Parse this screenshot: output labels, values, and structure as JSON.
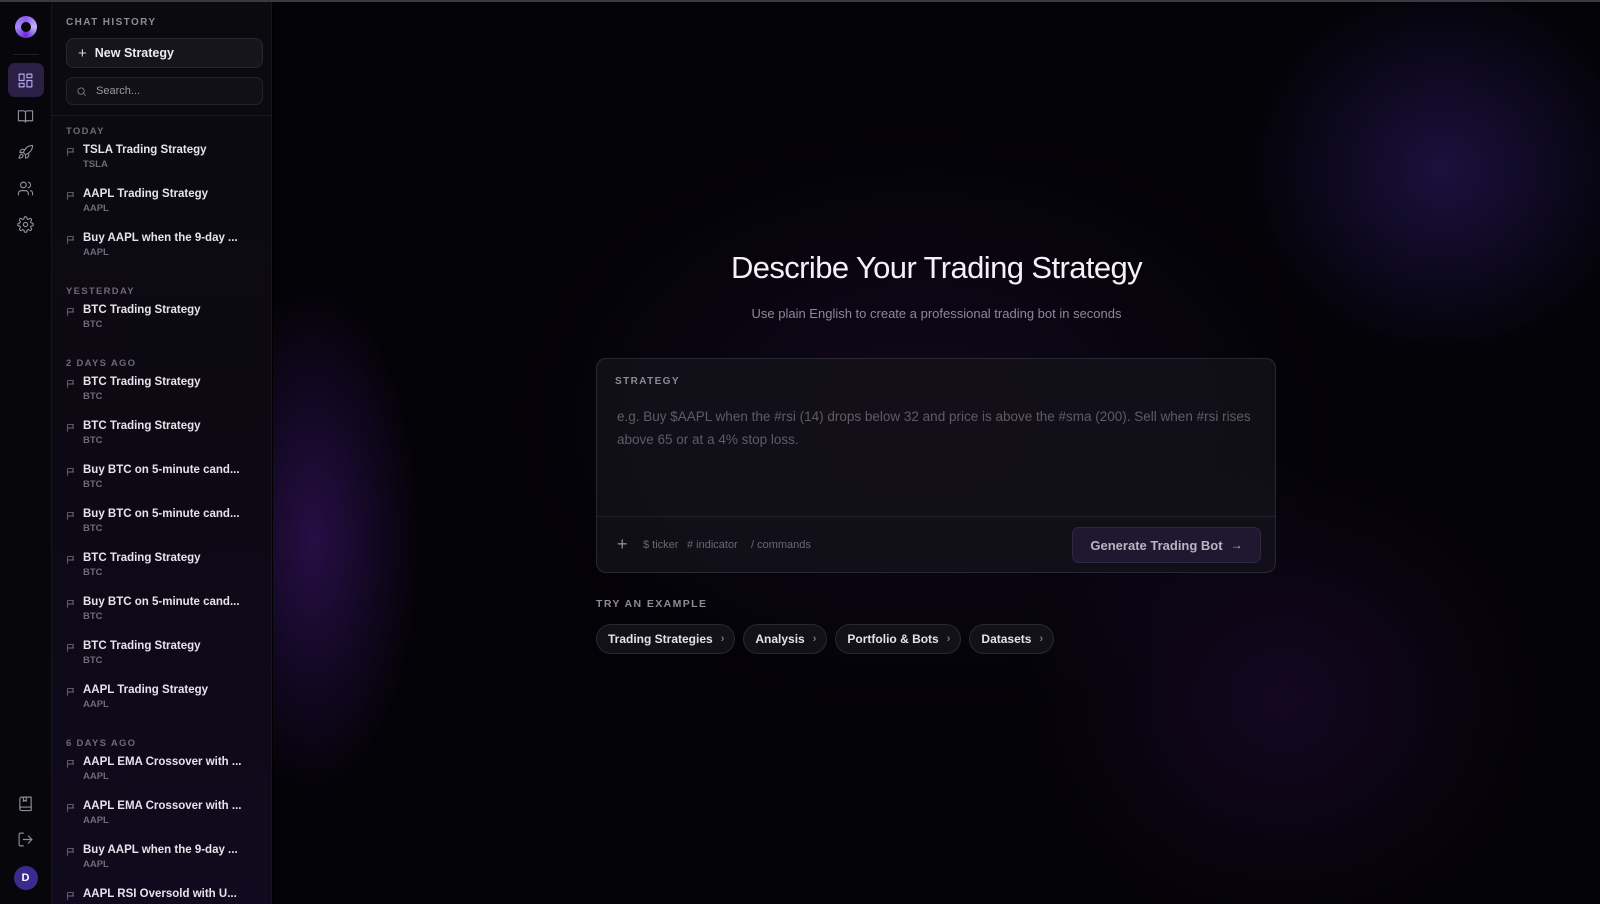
{
  "sidebar": {
    "title": "CHAT HISTORY",
    "new_button": "New Strategy",
    "search_placeholder": "Search...",
    "groups": [
      {
        "label": "TODAY",
        "items": [
          {
            "title": "TSLA Trading Strategy",
            "ticker": "TSLA"
          },
          {
            "title": "AAPL Trading Strategy",
            "ticker": "AAPL"
          },
          {
            "title": "Buy AAPL when the 9-day ...",
            "ticker": "AAPL"
          }
        ]
      },
      {
        "label": "YESTERDAY",
        "items": [
          {
            "title": "BTC Trading Strategy",
            "ticker": "BTC"
          }
        ]
      },
      {
        "label": "2 DAYS AGO",
        "items": [
          {
            "title": "BTC Trading Strategy",
            "ticker": "BTC"
          },
          {
            "title": "BTC Trading Strategy",
            "ticker": "BTC"
          },
          {
            "title": "Buy BTC on 5-minute cand...",
            "ticker": "BTC"
          },
          {
            "title": "Buy BTC on 5-minute cand...",
            "ticker": "BTC"
          },
          {
            "title": "BTC Trading Strategy",
            "ticker": "BTC"
          },
          {
            "title": "Buy BTC on 5-minute cand...",
            "ticker": "BTC"
          },
          {
            "title": "BTC Trading Strategy",
            "ticker": "BTC"
          },
          {
            "title": "AAPL Trading Strategy",
            "ticker": "AAPL"
          }
        ]
      },
      {
        "label": "6 DAYS AGO",
        "items": [
          {
            "title": "AAPL EMA Crossover with ...",
            "ticker": "AAPL"
          },
          {
            "title": "AAPL EMA Crossover with ...",
            "ticker": "AAPL"
          },
          {
            "title": "Buy AAPL when the 9-day ...",
            "ticker": "AAPL"
          },
          {
            "title": "AAPL RSI Oversold with U...",
            "ticker": "AAPL"
          }
        ]
      }
    ]
  },
  "rail": {
    "icons": [
      "dashboard-icon",
      "book-open-icon",
      "rocket-icon",
      "users-icon",
      "gear-icon"
    ],
    "bottom_icons": [
      "bookmark-book-icon",
      "logout-icon"
    ],
    "avatar_initial": "D",
    "accent": "#2a1f44"
  },
  "main": {
    "title": "Describe Your Trading Strategy",
    "subtitle": "Use plain English to create a professional trading bot in seconds",
    "strategy_label": "STRATEGY",
    "strategy_placeholder": "e.g. Buy $AAPL when the #rsi (14) drops below 32 and price is above the #sma (200). Sell when #rsi rises above 65 or at a 4% stop loss.",
    "hints": {
      "ticker": "$ ticker",
      "indicator": "# indicator",
      "commands": "/ commands"
    },
    "generate_button": "Generate Trading Bot",
    "try_label": "TRY AN EXAMPLE",
    "chips": [
      "Trading Strategies",
      "Analysis",
      "Portfolio & Bots",
      "Datasets"
    ]
  }
}
